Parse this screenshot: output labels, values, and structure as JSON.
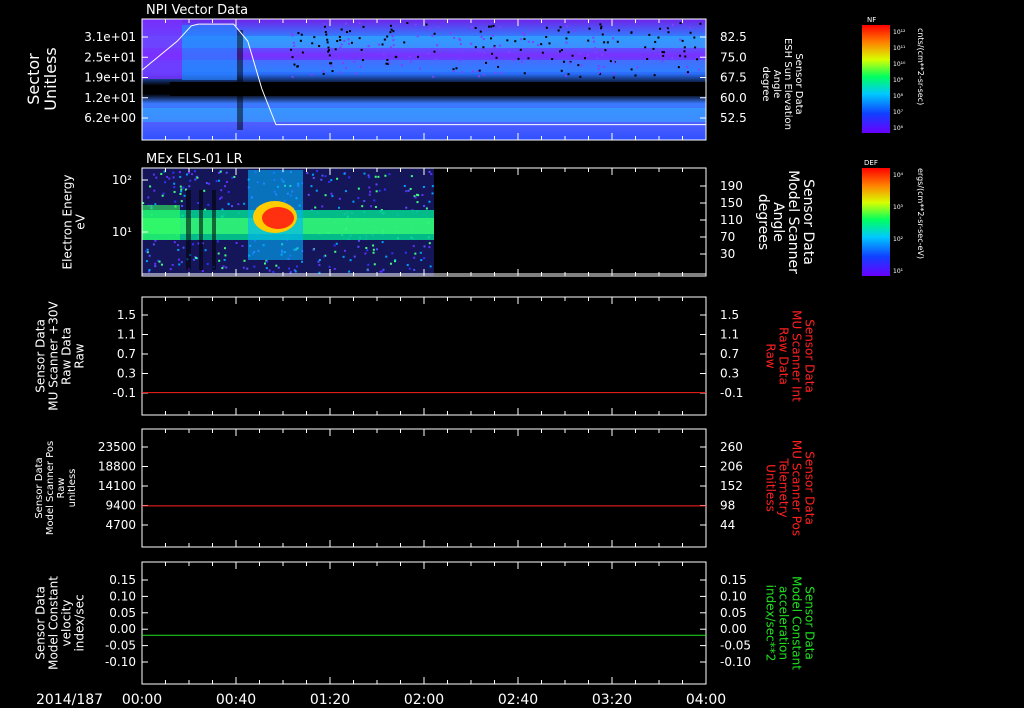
{
  "date_label": "2014/187",
  "time_ticks": [
    "00:00",
    "00:40",
    "01:20",
    "02:00",
    "02:40",
    "03:20",
    "04:00"
  ],
  "colorbars": [
    {
      "tag": "NF",
      "unit": "cnts/(cm**2-sr-sec)",
      "ticks": [
        "10¹²",
        "10¹¹",
        "10¹⁰",
        "10⁹",
        "10⁸",
        "10⁷",
        "10⁶"
      ]
    },
    {
      "tag": "DEF",
      "unit": "ergs/(cm**2-sr-sec-eV)",
      "ticks": [
        "10⁴",
        "10³",
        "10²",
        "10¹"
      ]
    }
  ],
  "colors": {
    "red": "#ff2020",
    "green": "#20e020",
    "white": "#ffffff",
    "axis": "#ffffff"
  },
  "chart_data": [
    {
      "type": "heatmap",
      "title": "NPI Vector Data",
      "ylabel": [
        "Sector",
        "Unitless"
      ],
      "yticks": [
        "3.1e+01",
        "2.5e+01",
        "1.9e+01",
        "1.2e+01",
        "6.2e+00"
      ],
      "right_axis_label": [
        "Sensor Data",
        "ESH Sun Elevation",
        "Angle",
        "degree"
      ],
      "right_ticks": [
        "82.5",
        "75.0",
        "67.5",
        "60.0",
        "52.5"
      ],
      "right_ylim": [
        47,
        82.5
      ],
      "overlay_line": {
        "x_hours": [
          0,
          0.25,
          0.35,
          0.4,
          0.55,
          0.6,
          0.65,
          0.75,
          0.85,
          0.95,
          4.0
        ],
        "y": [
          67.5,
          76,
          80.5,
          81,
          81,
          81,
          81,
          76,
          62,
          51.5,
          51.5
        ]
      }
    },
    {
      "type": "heatmap",
      "title": "MEx ELS-01 LR",
      "ylabel": [
        "Electron Energy",
        "eV"
      ],
      "yticks": [
        "10²",
        "10¹"
      ],
      "right_axis_label": [
        "Sensor Data",
        "Model Scanner",
        "Angle",
        "degrees"
      ],
      "right_ticks": [
        "190",
        "150",
        "110",
        "70",
        "30"
      ],
      "right_ylim": [
        8,
        190
      ],
      "data_extent_hours": [
        0,
        2.08
      ],
      "overlay_line": {
        "x_hours": [
          0,
          4.0
        ],
        "y": [
          15,
          15
        ]
      }
    },
    {
      "type": "line",
      "ylabel": [
        "Sensor Data",
        "MU Scanner +30V",
        "Raw Data",
        "Raw"
      ],
      "yticks": [
        "1.5",
        "1.1",
        "0.7",
        "0.3",
        "-0.1"
      ],
      "ylim": [
        -0.35,
        1.5
      ],
      "right_axis_label": [
        "Sensor Data",
        "MU Scanner Int",
        "Raw Data",
        "Raw"
      ],
      "right_ticks": [
        "1.5",
        "1.1",
        "0.7",
        "0.3",
        "-0.1"
      ],
      "series": [
        {
          "color": "red",
          "x_hours": [
            0,
            4.0
          ],
          "y": [
            0.0,
            0.0
          ]
        }
      ]
    },
    {
      "type": "line",
      "ylabel": [
        "Sensor Data",
        "Model Scanner Pos",
        "Raw",
        "unitless"
      ],
      "yticks": [
        "23500",
        "18800",
        "14100",
        "9400",
        "4700"
      ],
      "ylim": [
        0,
        23500
      ],
      "right_axis_label": [
        "Sensor Data",
        "MU Scanner Pos",
        "Telemetry",
        "Unitless"
      ],
      "right_ticks": [
        "260",
        "206",
        "152",
        "98",
        "44"
      ],
      "right_ylim": [
        0,
        260
      ],
      "series": [
        {
          "color": "red",
          "x_hours": [
            0,
            4.0
          ],
          "y": [
            8200,
            8200
          ]
        }
      ]
    },
    {
      "type": "line",
      "ylabel": [
        "Sensor Data",
        "Model Constant",
        "velocity",
        "index/sec"
      ],
      "yticks": [
        "0.15",
        "0.10",
        "0.05",
        "0.00",
        "-0.05",
        "-0.10"
      ],
      "ylim": [
        -0.1,
        0.15
      ],
      "right_axis_label": [
        "Sensor Data",
        "Model Constant",
        "acceleration",
        "index/sec**2"
      ],
      "right_ticks": [
        "0.15",
        "0.10",
        "0.05",
        "0.00",
        "-0.05",
        "-0.10"
      ],
      "series": [
        {
          "color": "green",
          "x_hours": [
            0,
            4.0
          ],
          "y": [
            0.0,
            0.0
          ]
        }
      ]
    }
  ]
}
